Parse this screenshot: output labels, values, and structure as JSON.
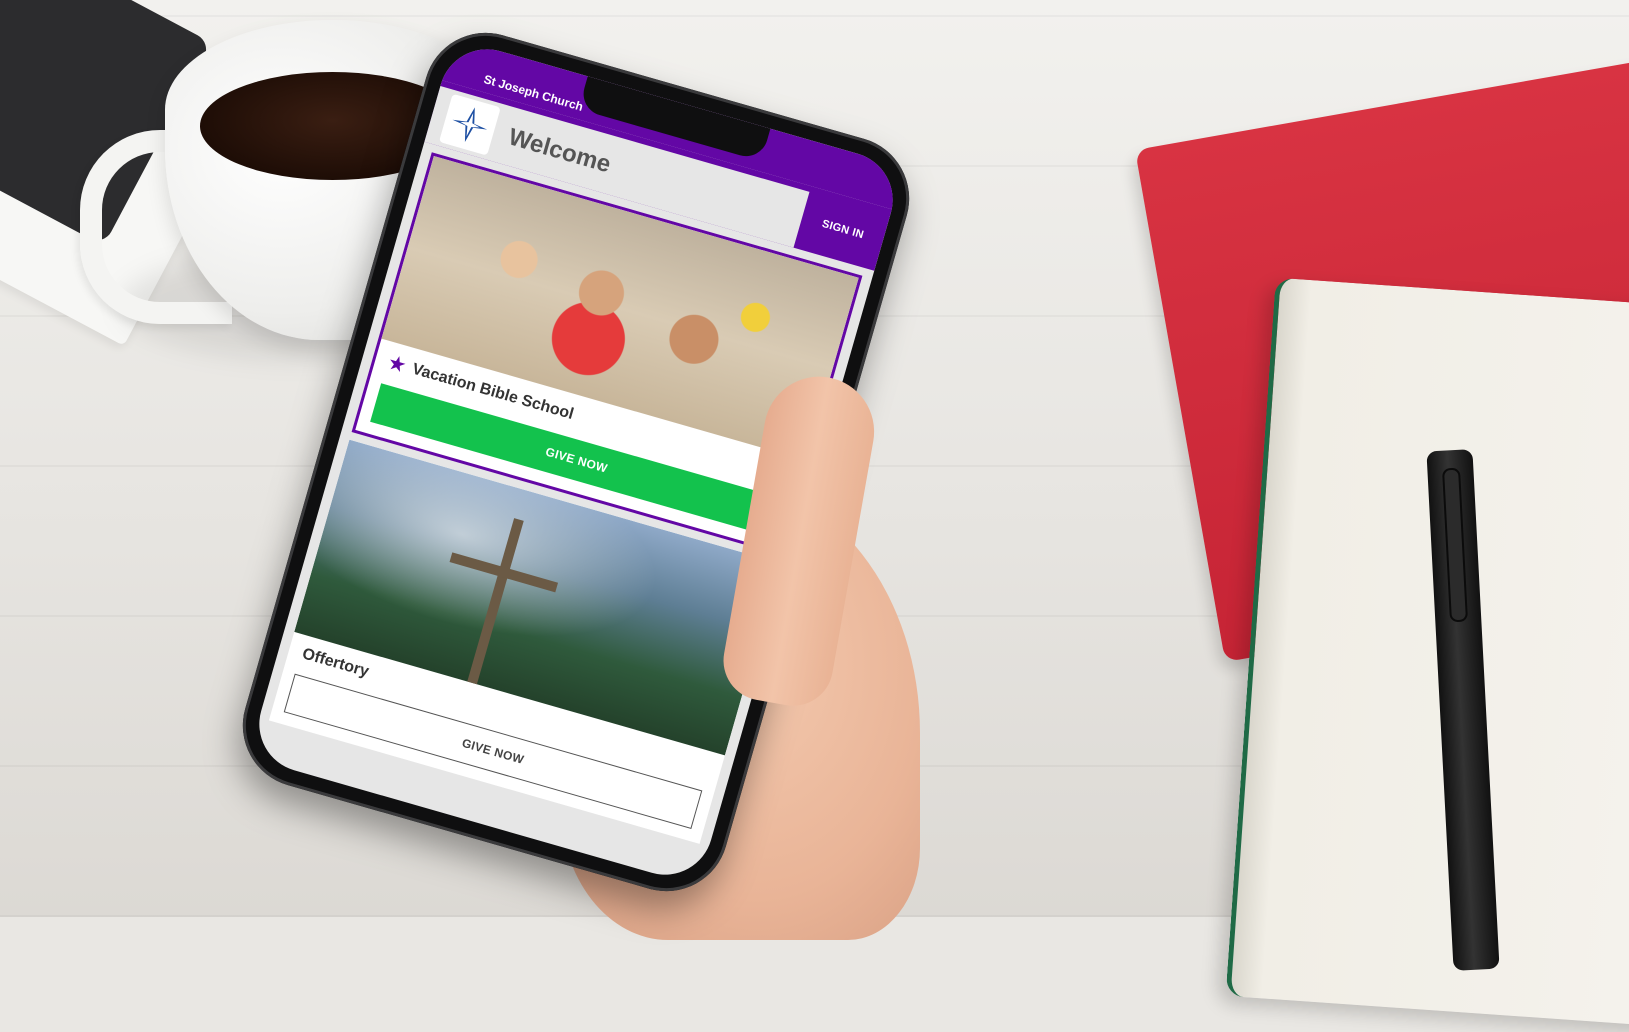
{
  "app": {
    "church_name": "St Joseph Church",
    "page_title": "Welcome",
    "sign_in_label": "SIGN IN",
    "accent_color": "#6307a5",
    "give_button_color": "#13c24d"
  },
  "cards": [
    {
      "title": "Vacation Bible School",
      "button_label": "GIVE NOW",
      "featured": true,
      "icon": "star-icon",
      "photo": "children-photo"
    },
    {
      "title": "Offertory",
      "button_label": "GIVE NOW",
      "featured": false,
      "photo": "mountain-cross-photo"
    }
  ]
}
